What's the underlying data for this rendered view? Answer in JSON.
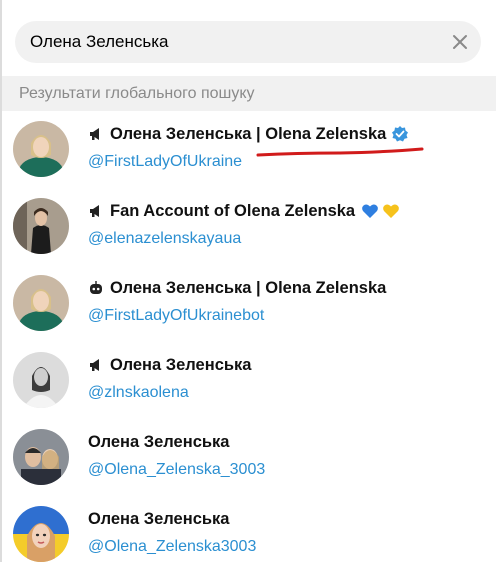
{
  "search": {
    "value": "Олена Зеленська",
    "clear_icon": "close-icon"
  },
  "section": {
    "title": "Результати глобального пошуку"
  },
  "colors": {
    "link": "#2b8fd1",
    "verified": "#3a96dd",
    "underline": "#d11b1b"
  },
  "results": [
    {
      "kind": "channel",
      "kind_icon": "megaphone-icon",
      "title": "Олена Зеленська | Olena Zelenska",
      "verified": true,
      "emoji": [],
      "handle": "@FirstLadyOfUkraine"
    },
    {
      "kind": "channel",
      "kind_icon": "megaphone-icon",
      "title": "Fan Account of Olena Zelenska",
      "verified": false,
      "emoji": [
        "blue-heart-icon",
        "yellow-heart-icon"
      ],
      "handle": "@elenazelenskayaua"
    },
    {
      "kind": "bot",
      "kind_icon": "bot-icon",
      "title": "Олена Зеленська | Olena Zelenska",
      "verified": false,
      "emoji": [],
      "handle": "@FirstLadyOfUkrainebot"
    },
    {
      "kind": "channel",
      "kind_icon": "megaphone-icon",
      "title": "Олена Зеленська",
      "verified": false,
      "emoji": [],
      "handle": "@zlnskaolena"
    },
    {
      "kind": "user",
      "kind_icon": "",
      "title": "Олена Зеленська",
      "verified": false,
      "emoji": [],
      "handle": "@Olena_Zelenska_3003"
    },
    {
      "kind": "user",
      "kind_icon": "",
      "title": "Олена Зеленська",
      "verified": false,
      "emoji": [],
      "handle": "@Olena_Zelenska3003"
    }
  ]
}
